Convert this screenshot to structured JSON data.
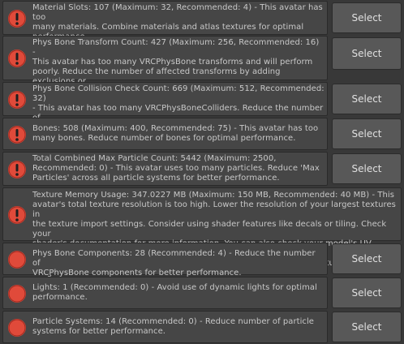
{
  "colors": {
    "background": "#383838",
    "message_bg": "#464646",
    "error_icon": "#e04a3a",
    "button_bg": "#585858",
    "text": "#c8c8c8"
  },
  "items": [
    {
      "icon": "error-exclamation-icon",
      "severity": "error",
      "text": "Material Slots: 107 (Maximum: 32, Recommended: 4) - This avatar has too\nmany materials. Combine materials and atlas textures for optimal\nperformance.",
      "button": "Select"
    },
    {
      "icon": "error-exclamation-icon",
      "severity": "error",
      "text": "Phys Bone Transform Count: 427 (Maximum: 256, Recommended: 16) -\nThis avatar has too many VRCPhysBone transforms and will perform\npoorly. Reduce the number of affected transforms by adding exclusions or\nremoving components.",
      "button": "Select"
    },
    {
      "icon": "error-exclamation-icon",
      "severity": "error",
      "text": "Phys Bone Collision Check Count: 669 (Maximum: 512, Recommended: 32)\n- This avatar has too many VRCPhysBoneColliders. Reduce the number of\nVRCPhysBoneColliders for better performance.",
      "button": "Select"
    },
    {
      "icon": "error-exclamation-icon",
      "severity": "error",
      "text": "Bones: 508 (Maximum: 400, Recommended: 75) - This avatar has too\nmany bones. Reduce number of bones for optimal performance.",
      "button": "Select"
    },
    {
      "icon": "error-exclamation-icon",
      "severity": "error",
      "text": "Total Combined Max Particle Count: 5442 (Maximum: 2500,\nRecommended: 0) - This avatar uses too many particles. Reduce 'Max\nParticles' across all particle systems for better performance.",
      "button": "Select"
    },
    {
      "icon": "error-exclamation-icon",
      "severity": "error",
      "text": "Texture Memory Usage: 347.0227 MB (Maximum: 150 MB, Recommended: 40 MB) - This\navatar's total texture resolution is too high. Lower the resolution of your largest textures in\nthe texture import settings. Consider using shader features like decals or tiling. Check your\nshader's documentation for more information. You can also check your model's UV layouts to\nbetter utilize texture space. These techniques may help you reduce texture memory usage.",
      "button": null
    },
    {
      "icon": "warning-circle-icon",
      "severity": "warning",
      "text": "Phys Bone Components: 28 (Recommended: 4) - Reduce the number of\nVRCPhysBone components for better performance.",
      "button": "Select"
    },
    {
      "icon": "warning-circle-icon",
      "severity": "warning",
      "text": "Lights: 1 (Recommended: 0) - Avoid use of dynamic lights for optimal\nperformance.",
      "button": "Select"
    },
    {
      "icon": "warning-circle-icon",
      "severity": "warning",
      "text": "Particle Systems: 14 (Recommended: 0) - Reduce number of particle\nsystems for better performance.",
      "button": "Select"
    }
  ]
}
